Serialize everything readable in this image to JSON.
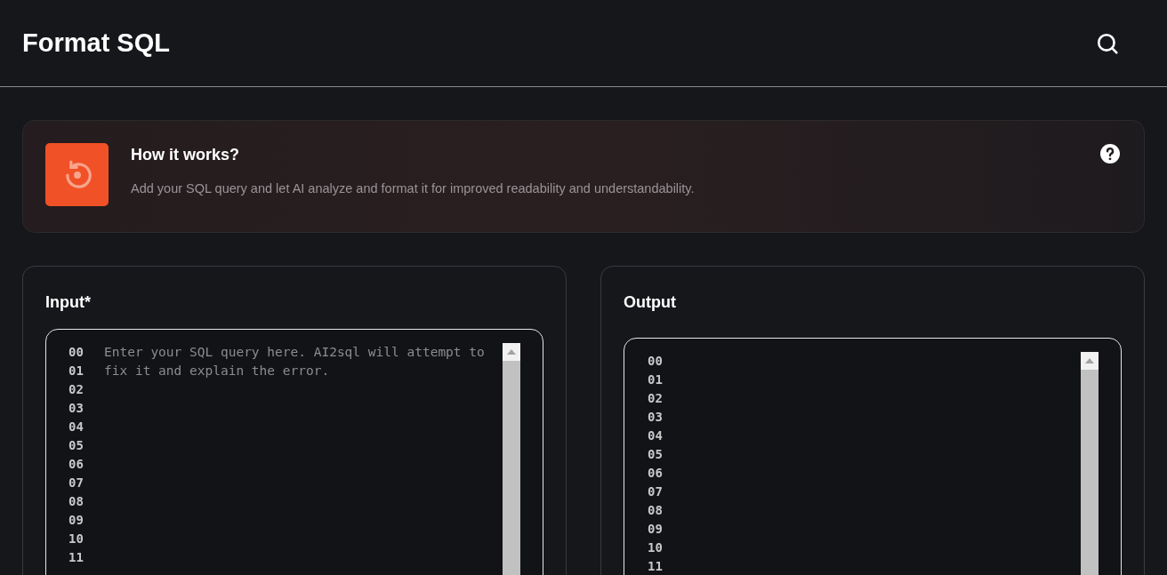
{
  "header": {
    "title": "Format SQL"
  },
  "info_card": {
    "title": "How it works?",
    "description": "Add your SQL query and let AI analyze and format it for improved readability and understandability."
  },
  "input_panel": {
    "label": "Input*",
    "placeholder": "Enter your SQL query here. AI2sql will attempt to fix it and explain the error.",
    "line_numbers": [
      "00",
      "01",
      "02",
      "03",
      "04",
      "05",
      "06",
      "07",
      "08",
      "09",
      "10",
      "11"
    ]
  },
  "output_panel": {
    "label": "Output",
    "line_numbers": [
      "00",
      "01",
      "02",
      "03",
      "04",
      "05",
      "06",
      "07",
      "08",
      "09",
      "10",
      "11"
    ]
  }
}
